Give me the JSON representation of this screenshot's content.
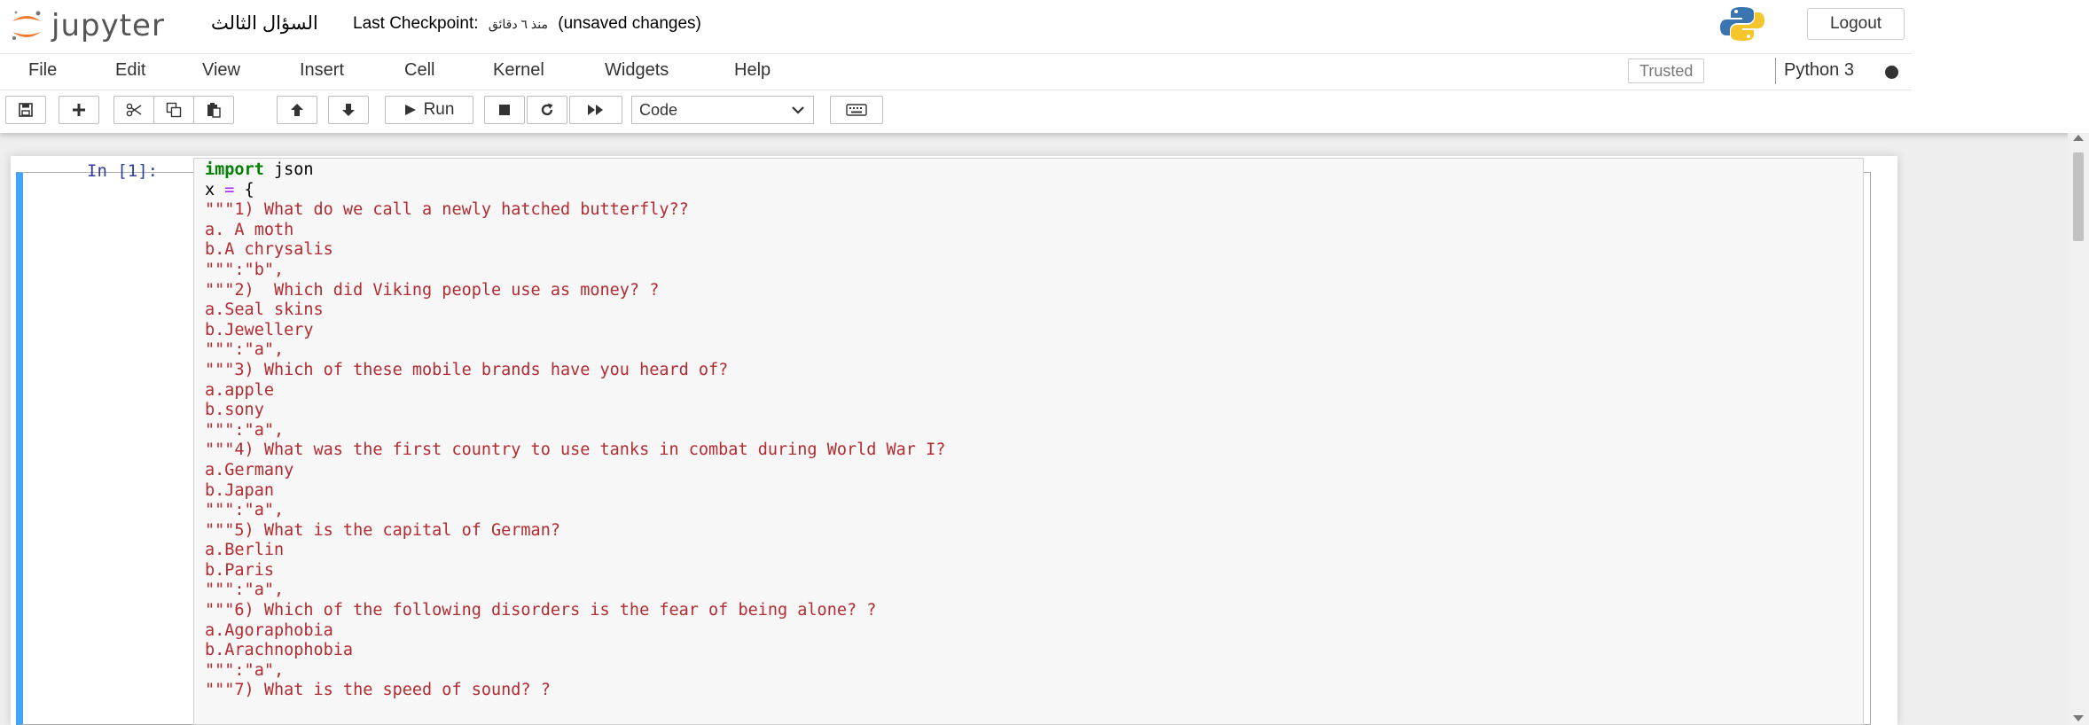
{
  "header": {
    "logo_text": "jupyter",
    "notebook_name": "السؤال الثالث",
    "checkpoint_label": "Last Checkpoint:",
    "checkpoint_time": "منذ ٦ دقائق",
    "unsaved": "(unsaved changes)",
    "logout_label": "Logout"
  },
  "menubar": {
    "items": [
      "File",
      "Edit",
      "View",
      "Insert",
      "Cell",
      "Kernel",
      "Widgets",
      "Help"
    ],
    "trusted_label": "Trusted",
    "kernel_name": "Python 3"
  },
  "toolbar": {
    "run_label": "Run",
    "cell_type": "Code"
  },
  "cell": {
    "prompt": "In [1]:",
    "code_lines": [
      "import json",
      "x = {",
      "\"\"\"1) What do we call a newly hatched butterfly??",
      "a. A moth",
      "b.A chrysalis",
      "\"\"\":\"b\",",
      "\"\"\"2)  Which did Viking people use as money? ?",
      "a.Seal skins",
      "b.Jewellery",
      "\"\"\":\"a\",",
      "\"\"\"3) Which of these mobile brands have you heard of?",
      "a.apple",
      "b.sony",
      "\"\"\":\"a\",",
      "\"\"\"4) What was the first country to use tanks in combat during World War I?",
      "a.Germany",
      "b.Japan",
      "\"\"\":\"a\",",
      "\"\"\"5) What is the capital of German?",
      "a.Berlin",
      "b.Paris",
      "\"\"\":\"a\",",
      "\"\"\"6) Which of the following disorders is the fear of being alone? ?",
      "a.Agoraphobia",
      "b.Arachnophobia",
      "\"\"\":\"a\",",
      "\"\"\"7) What is the speed of sound? ?"
    ]
  },
  "colors": {
    "accent": "#42a5f5",
    "string": "#b22b31",
    "keyword": "#008000",
    "prompt": "#303f9f"
  }
}
